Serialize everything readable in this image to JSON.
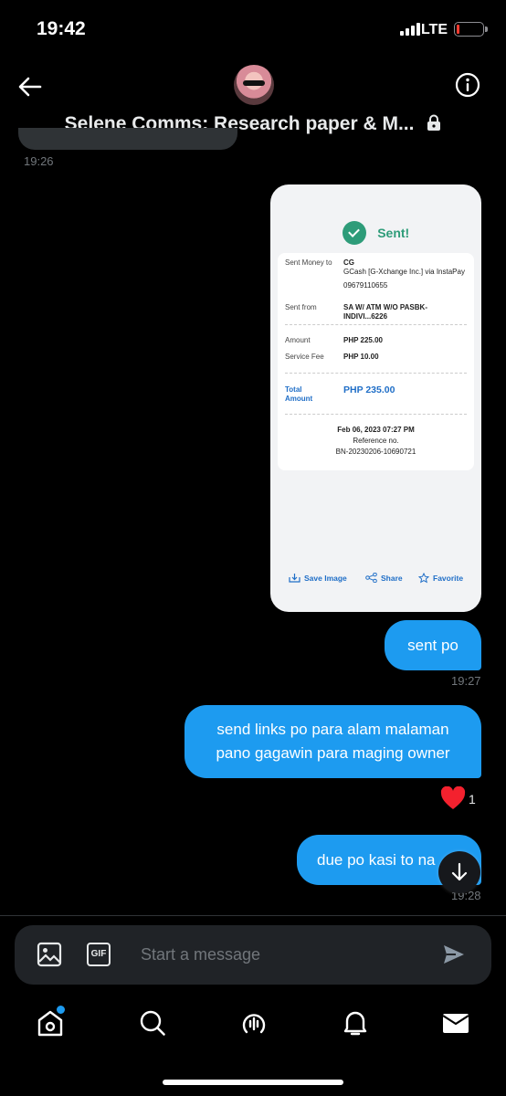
{
  "status_bar": {
    "time": "19:42",
    "network": "LTE",
    "battery_level": 0.08
  },
  "header": {
    "title": "Selene Comms: Research paper & M...",
    "avatar": "user-avatar",
    "back_icon": "arrow-left-icon",
    "info_icon": "info-circle-icon",
    "lock_icon": "lock-icon"
  },
  "messages": {
    "prev_timestamp": "19:26",
    "receipt": {
      "status": "Sent!",
      "sent_to_label": "Sent Money to",
      "recipient_name": "CG",
      "recipient_bank": "GCash [G-Xchange Inc.] via InstaPay",
      "recipient_number": "09679110655",
      "sent_from_label": "Sent from",
      "sent_from_value": "SA W/ ATM W/O PASBK-INDIVI...6226",
      "amount_label": "Amount",
      "amount_value": "PHP 225.00",
      "fee_label": "Service Fee",
      "fee_value": "PHP 10.00",
      "total_label": "Total Amount",
      "total_value": "PHP 235.00",
      "datetime": "Feb 06, 2023 07:27 PM",
      "reference_label": "Reference no.",
      "reference_value": "BN-20230206-10690721",
      "save_label": "Save Image",
      "share_label": "Share",
      "favorite_label": "Favorite"
    },
    "msg1": {
      "text": "sent po",
      "timestamp": "19:27"
    },
    "msg2": {
      "text": "send links po para alam malaman pano gagawin para maging owner",
      "reaction_count": "1",
      "reaction_icon": "heart-icon"
    },
    "msg3": {
      "text": "due po kasi to na",
      "timestamp": "19:28"
    }
  },
  "composer": {
    "placeholder": "Start a message",
    "image_icon": "image-icon",
    "gif_label": "GIF",
    "send_icon": "send-icon"
  },
  "tab_bar": {
    "items": [
      "home-icon",
      "search-icon",
      "spaces-icon",
      "notifications-icon",
      "messages-icon"
    ]
  },
  "colors": {
    "accent": "#1d9bf0",
    "background": "#000000",
    "sent_green": "#2e9c79",
    "heart": "#f91880"
  }
}
